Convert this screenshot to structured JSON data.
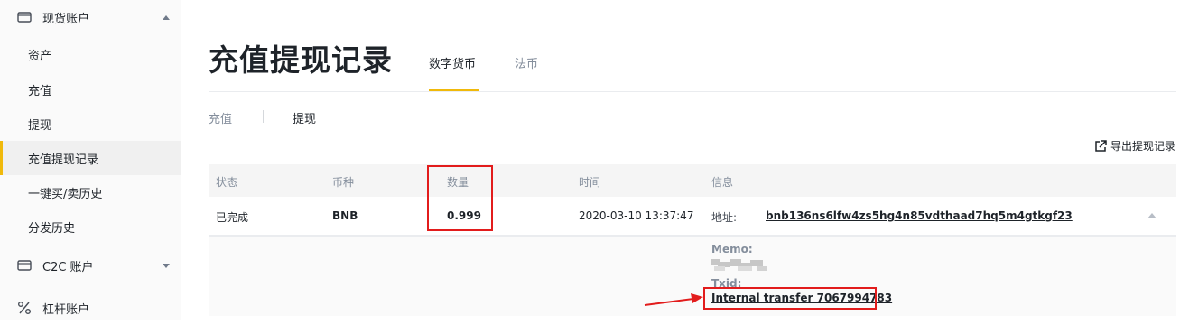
{
  "sidebar": {
    "spot_account": "现货账户",
    "items": [
      "资产",
      "充值",
      "提现",
      "充值提现记录",
      "一键买/卖历史",
      "分发历史"
    ],
    "c2c_account": "C2C 账户",
    "margin_account": "杠杆账户"
  },
  "page": {
    "title": "充值提现记录",
    "tabs": [
      "数字货币",
      "法币"
    ],
    "subtabs": [
      "充值",
      "提现"
    ],
    "export_label": "导出提现记录"
  },
  "table": {
    "headers": [
      "状态",
      "币种",
      "数量",
      "时间",
      "信息"
    ],
    "row": {
      "status": "已完成",
      "coin": "BNB",
      "amount": "0.999",
      "time": "2020-03-10 13:37:47",
      "address_label": "地址:",
      "address": "bnb136ns6lfw4zs5hg4n85vdthaad7hq5m4gtkgf23"
    },
    "detail": {
      "memo_label": "Memo:",
      "txid_label": "Txid:",
      "txid": "Internal transfer 7067994783"
    }
  },
  "colors": {
    "accent": "#f0b90b",
    "highlight": "#e21c1c"
  }
}
